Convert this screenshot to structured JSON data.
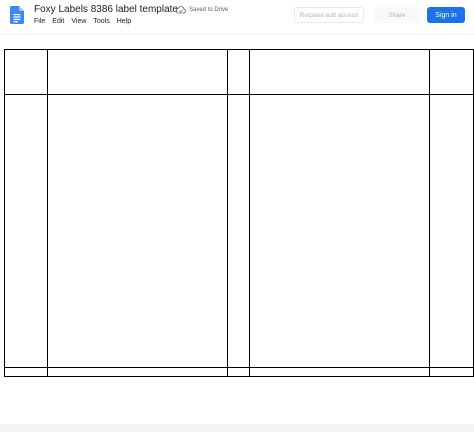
{
  "document": {
    "title": "Foxy Labels 8386 label template",
    "save_status": "Saved to Drive"
  },
  "menu": [
    "File",
    "Edit",
    "View",
    "Tools",
    "Help"
  ],
  "actions": {
    "request_edit_access": "Request edit access",
    "share": "Share",
    "sign_in": "Sign in"
  },
  "colors": {
    "docs_blue": "#4285f4",
    "sign_in_button": "#1a73e8",
    "disabled_text": "#b0b4b8",
    "table_border": "#000000"
  },
  "icons": {
    "app": "google-docs-icon",
    "save_status": "cloud-done-icon"
  },
  "label_table": {
    "rows": 3,
    "columns": 5,
    "cells_empty": true
  }
}
